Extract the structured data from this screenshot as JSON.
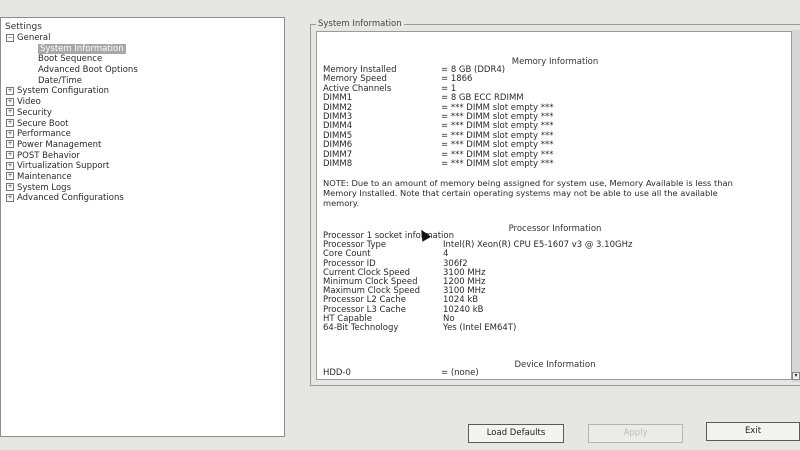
{
  "left_panel": {
    "title": "Settings",
    "tree": [
      {
        "label": "General",
        "expand": "−",
        "indent": 0
      },
      {
        "label": "System Information",
        "expand": "",
        "indent": 1,
        "selected": true
      },
      {
        "label": "Boot Sequence",
        "expand": "",
        "indent": 1
      },
      {
        "label": "Advanced Boot Options",
        "expand": "",
        "indent": 1
      },
      {
        "label": "Date/Time",
        "expand": "",
        "indent": 1
      },
      {
        "label": "System Configuration",
        "expand": "+",
        "indent": 0
      },
      {
        "label": "Video",
        "expand": "+",
        "indent": 0
      },
      {
        "label": "Security",
        "expand": "+",
        "indent": 0
      },
      {
        "label": "Secure Boot",
        "expand": "+",
        "indent": 0
      },
      {
        "label": "Performance",
        "expand": "+",
        "indent": 0
      },
      {
        "label": "Power Management",
        "expand": "+",
        "indent": 0
      },
      {
        "label": "POST Behavior",
        "expand": "+",
        "indent": 0
      },
      {
        "label": "Virtualization Support",
        "expand": "+",
        "indent": 0
      },
      {
        "label": "Maintenance",
        "expand": "+",
        "indent": 0
      },
      {
        "label": "System Logs",
        "expand": "+",
        "indent": 0
      },
      {
        "label": "Advanced Configurations",
        "expand": "+",
        "indent": 0
      }
    ]
  },
  "right_panel": {
    "frame_title": "System Information",
    "memory": {
      "title": "Memory Information",
      "rows": [
        {
          "k": "Memory Installed",
          "v": "= 8 GB (DDR4)"
        },
        {
          "k": "Memory Speed",
          "v": "= 1866"
        },
        {
          "k": "Active Channels",
          "v": "= 1"
        },
        {
          "k": "DIMM1",
          "v": "= 8 GB ECC RDIMM"
        },
        {
          "k": "DIMM2",
          "v": "= *** DIMM slot empty ***"
        },
        {
          "k": "DIMM3",
          "v": "= *** DIMM slot empty ***"
        },
        {
          "k": "DIMM4",
          "v": "= *** DIMM slot empty ***"
        },
        {
          "k": "DIMM5",
          "v": "= *** DIMM slot empty ***"
        },
        {
          "k": "DIMM6",
          "v": "= *** DIMM slot empty ***"
        },
        {
          "k": "DIMM7",
          "v": "= *** DIMM slot empty ***"
        },
        {
          "k": "DIMM8",
          "v": "= *** DIMM slot empty ***"
        }
      ],
      "note": "NOTE: Due to an amount of memory being assigned for system use, Memory Available is less than Memory Installed. Note that certain operating systems may not be able to use all the available memory."
    },
    "processor": {
      "title": "Processor Information",
      "rows": [
        {
          "k": "Processor 1 socket information",
          "v": ""
        },
        {
          "k": "Processor Type",
          "v": "Intel(R) Xeon(R) CPU E5-1607 v3 @ 3.10GHz"
        },
        {
          "k": "Core Count",
          "v": "4"
        },
        {
          "k": "Processor ID",
          "v": "306f2"
        },
        {
          "k": "Current Clock Speed",
          "v": "3100 MHz"
        },
        {
          "k": "Minimum Clock Speed",
          "v": "1200 MHz"
        },
        {
          "k": "Maximum Clock Speed",
          "v": "3100 MHz"
        },
        {
          "k": "Processor L2 Cache",
          "v": "1024 kB"
        },
        {
          "k": "Processor L3 Cache",
          "v": "10240 kB"
        },
        {
          "k": "HT Capable",
          "v": "No"
        },
        {
          "k": "64-Bit Technology",
          "v": "Yes (Intel EM64T)"
        }
      ]
    },
    "device": {
      "title": "Device Information",
      "rows": [
        {
          "k": "HDD-0",
          "v": "= (none)"
        }
      ]
    }
  },
  "buttons": {
    "load_defaults": "Load Defaults",
    "apply": "Apply",
    "exit": "Exit"
  }
}
